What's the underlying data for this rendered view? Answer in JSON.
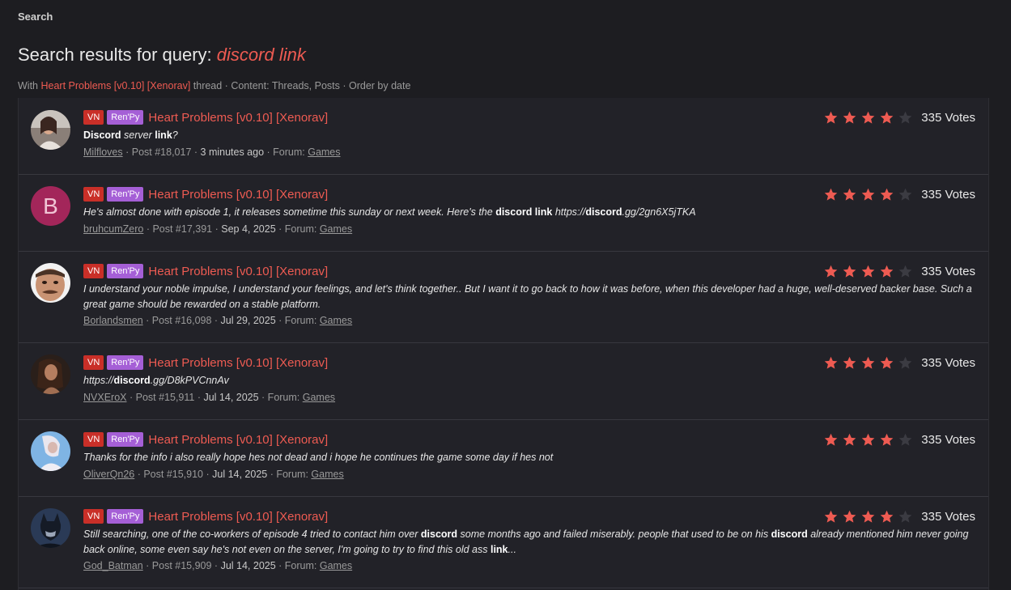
{
  "breadcrumb": "Search",
  "heading": {
    "prefix": "Search results for query: ",
    "query": "discord link"
  },
  "filters": {
    "with": "With ",
    "thread_link": "Heart Problems [v0.10] [Xenorav]",
    "suffix": " thread · Content: Threads, Posts · Order by date"
  },
  "colors": {
    "accent": "#ee5b52",
    "vn_tag": "#c92f28",
    "renpy_tag": "#a55fd6",
    "star_empty": "#3b3b42"
  },
  "results": [
    {
      "avatar": "user-photo-avatar",
      "tags": [
        "VN",
        "Ren'Py"
      ],
      "thread": "Heart Problems [v0.10] [Xenorav]",
      "rating": 4,
      "votes": "335 Votes",
      "snippet": [
        "Discord",
        " server ",
        "link",
        "?"
      ],
      "user": "Milfloves",
      "post": " · Post #18,017 · ",
      "date": "3 minutes ago",
      "forum_prefix": " · Forum: ",
      "forum": "Games"
    },
    {
      "avatar": "B",
      "tags": [
        "VN",
        "Ren'Py"
      ],
      "thread": "Heart Problems [v0.10] [Xenorav]",
      "rating": 4,
      "votes": "335 Votes",
      "snippet": [
        "He's almost done with episode 1, it releases sometime this sunday or next week. Here's the ",
        "discord link",
        " https://",
        "discord",
        ".gg/2gn6X5jTKA"
      ],
      "user": "bruhcumZero",
      "post": " · Post #17,391 · ",
      "date": "Sep 4, 2025",
      "forum_prefix": " · Forum: ",
      "forum": "Games"
    },
    {
      "avatar": "user-photo-avatar",
      "tags": [
        "VN",
        "Ren'Py"
      ],
      "thread": "Heart Problems [v0.10] [Xenorav]",
      "rating": 4,
      "votes": "335 Votes",
      "snippet": [
        "I understand your noble impulse, I understand your feelings, and let's think together.. But I want it to go back to how it was before, when this developer had a huge, well-deserved backer base. Such a great game should be rewarded on a stable platform."
      ],
      "user": "Borlandsmen",
      "post": " · Post #16,098 · ",
      "date": "Jul 29, 2025",
      "forum_prefix": " · Forum: ",
      "forum": "Games"
    },
    {
      "avatar": "user-photo-avatar",
      "tags": [
        "VN",
        "Ren'Py"
      ],
      "thread": "Heart Problems [v0.10] [Xenorav]",
      "rating": 4,
      "votes": "335 Votes",
      "snippet": [
        "https://",
        "discord",
        ".gg/D8kPVCnnAv"
      ],
      "user": "NVXEroX",
      "post": " · Post #15,911 · ",
      "date": "Jul 14, 2025",
      "forum_prefix": " · Forum: ",
      "forum": "Games"
    },
    {
      "avatar": "user-photo-avatar",
      "tags": [
        "VN",
        "Ren'Py"
      ],
      "thread": "Heart Problems [v0.10] [Xenorav]",
      "rating": 4,
      "votes": "335 Votes",
      "snippet": [
        "Thanks for the info i also really hope hes not dead and i hope he continues the game some day if hes not"
      ],
      "user": "OliverQn26",
      "post": " · Post #15,910 · ",
      "date": "Jul 14, 2025",
      "forum_prefix": " · Forum: ",
      "forum": "Games"
    },
    {
      "avatar": "user-photo-avatar",
      "tags": [
        "VN",
        "Ren'Py"
      ],
      "thread": "Heart Problems [v0.10] [Xenorav]",
      "rating": 4,
      "votes": "335 Votes",
      "snippet": [
        "Still searching, one of the co-workers of episode 4 tried to contact him over ",
        "discord",
        " some months ago and failed miserably. people that used to be on his ",
        "discord",
        " already mentioned him never going back online, some even say he's not even on the server, I'm going to try to find this old ass ",
        "link",
        "..."
      ],
      "user": "God_Batman",
      "post": " · Post #15,909 · ",
      "date": "Jul 14, 2025",
      "forum_prefix": " · Forum: ",
      "forum": "Games"
    }
  ]
}
